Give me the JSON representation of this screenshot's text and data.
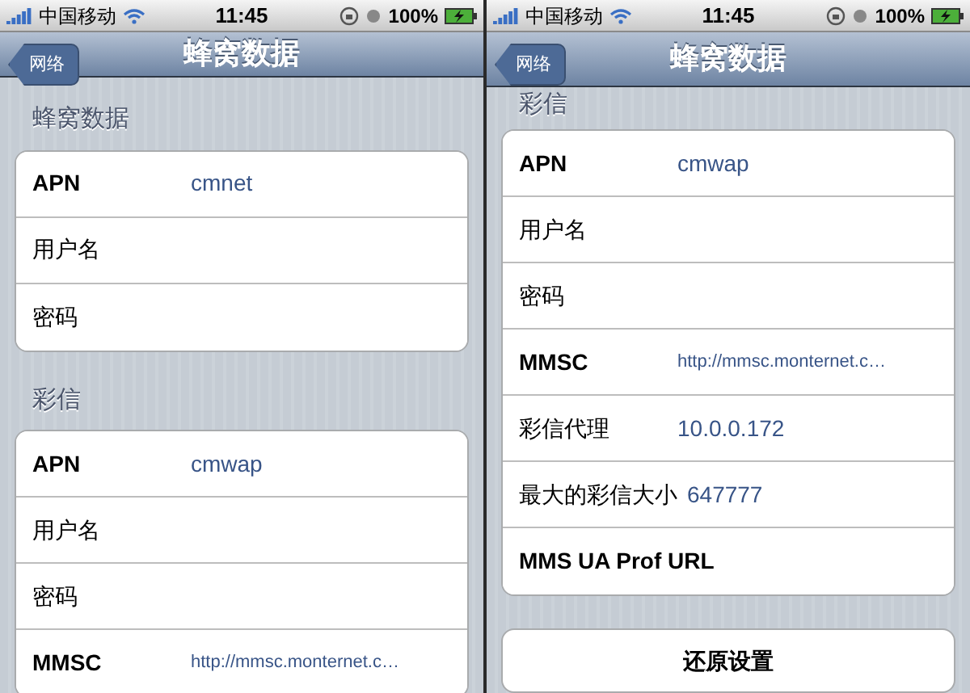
{
  "screens": [
    {
      "status_bar": {
        "carrier": "中国移动",
        "time": "11:45",
        "battery": "100%"
      },
      "nav_bar": {
        "back": "网络",
        "title": "蜂窝数据"
      },
      "groups": [
        {
          "header": "蜂窝数据",
          "rows": [
            {
              "label": "APN",
              "value": "cmnet",
              "bold": true
            },
            {
              "label": "用户名",
              "bold": false
            },
            {
              "label": "密码",
              "bold": false
            }
          ]
        },
        {
          "header": "彩信",
          "rows": [
            {
              "label": "APN",
              "value": "cmwap",
              "bold": true
            },
            {
              "label": "用户名",
              "bold": false
            },
            {
              "label": "密码",
              "bold": false
            },
            {
              "label": "MMSC",
              "value": "http://mmsc.monternet.c…",
              "bold": true
            }
          ]
        }
      ]
    },
    {
      "status_bar": {
        "carrier": "中国移动",
        "time": "11:45",
        "battery": "100%"
      },
      "nav_bar": {
        "back": "网络",
        "title": "蜂窝数据"
      },
      "groups": [
        {
          "header": "彩信",
          "rows": [
            {
              "label": "APN",
              "value": "cmwap",
              "bold": true
            },
            {
              "label": "用户名",
              "bold": false
            },
            {
              "label": "密码",
              "bold": false
            },
            {
              "label": "MMSC",
              "value": "http://mmsc.monternet.c…",
              "bold": true
            },
            {
              "label": "彩信代理",
              "value": "10.0.0.172",
              "bold": false
            },
            {
              "label": "最大的彩信大小",
              "value": "647777",
              "bold": false
            },
            {
              "label": "MMS UA Prof URL",
              "bold": true
            }
          ]
        }
      ],
      "button": "还原设置"
    }
  ]
}
